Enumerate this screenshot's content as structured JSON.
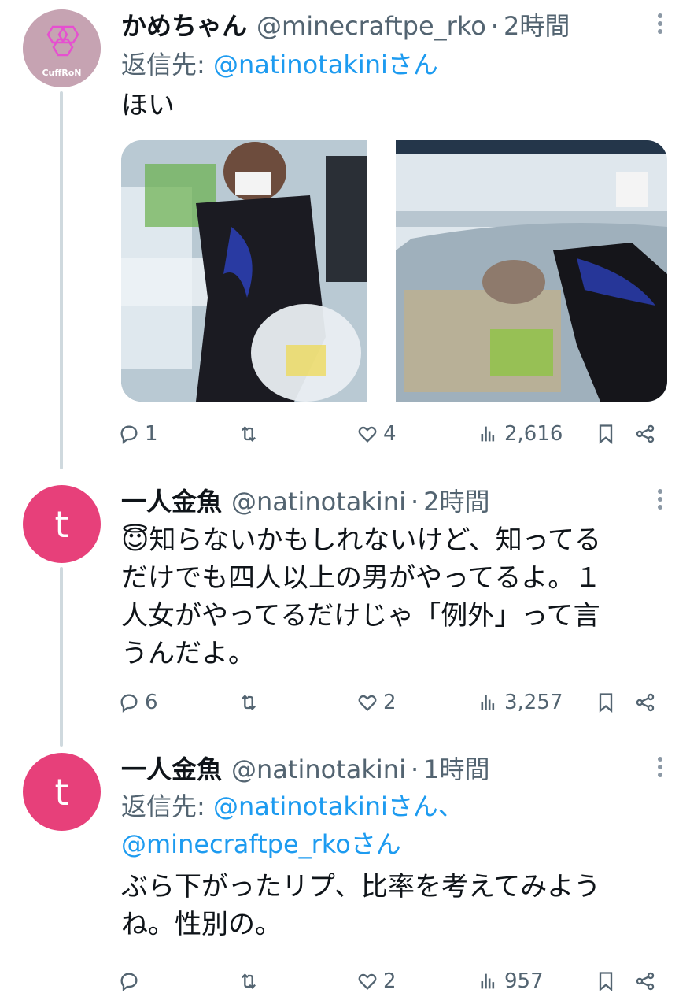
{
  "tweets": [
    {
      "avatar_text": "CuffRoN",
      "name": "かめちゃん",
      "handle": "@minecraftpe_rko",
      "time": "2時間",
      "reply_label": "返信先: ",
      "reply_to": "@natinotakiniさん",
      "text": "ほい",
      "stats": {
        "replies": "1",
        "retweets": "",
        "likes": "4",
        "views": "2,616"
      }
    },
    {
      "avatar_text": "t",
      "name": "一人金魚",
      "handle": "@natinotakini",
      "time": "2時間",
      "text_lines": [
        "😇知らないかもしれないけど、知ってる",
        "だけでも四人以上の男がやってるよ。１",
        "人女がやってるだけじゃ「例外」って言",
        "うんだよ。"
      ],
      "stats": {
        "replies": "6",
        "retweets": "",
        "likes": "2",
        "views": "3,257"
      }
    },
    {
      "avatar_text": "t",
      "name": "一人金魚",
      "handle": "@natinotakini",
      "time": "1時間",
      "reply_label": "返信先: ",
      "reply_to_1": "@natinotakiniさん、",
      "reply_to_2": "@minecraftpe_rkoさん",
      "text_lines": [
        "ぶら下がったリプ、比率を考えてみよう",
        "ね。性別の。"
      ],
      "stats": {
        "replies": "",
        "retweets": "",
        "likes": "2",
        "views": "957"
      }
    }
  ],
  "icons": [
    "reply-icon",
    "retweet-icon",
    "like-icon",
    "views-icon",
    "bookmark-icon",
    "share-icon",
    "more-icon"
  ],
  "colors": {
    "link": "#1d9bf0",
    "secondary_text": "#536471",
    "avatar_t": "#e7407a",
    "thread_line": "#cfd9de"
  }
}
